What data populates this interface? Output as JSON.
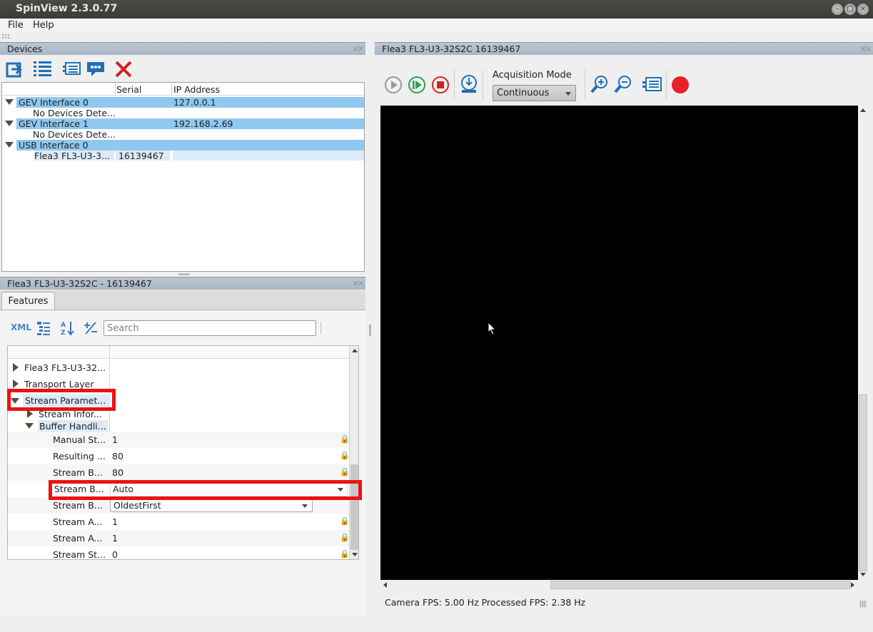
{
  "window": {
    "title": "SpinView 2.3.0.77"
  },
  "menu": {
    "file": "File",
    "help": "Help"
  },
  "devices": {
    "title": "Devices",
    "columns": {
      "serial": "Serial",
      "ip": "IP Address"
    },
    "rows": [
      {
        "name": "GEV Interface 0",
        "serial": "",
        "ip": "127.0.0.1"
      },
      {
        "name": "No Devices Dete...",
        "serial": "",
        "ip": ""
      },
      {
        "name": "GEV Interface 1",
        "serial": "",
        "ip": "192.168.2.69"
      },
      {
        "name": "No Devices Dete...",
        "serial": "",
        "ip": ""
      },
      {
        "name": "USB Interface 0",
        "serial": "",
        "ip": ""
      },
      {
        "name": "Flea3 FL3-U3-3...",
        "serial": "16139467",
        "ip": ""
      }
    ]
  },
  "camera_panel": {
    "title": "Flea3 FL3-U3-32S2C - 16139467",
    "tab": "Features",
    "xml_label": "XML",
    "search_placeholder": "Search",
    "tree": [
      {
        "label": "Flea3 FL3-U3-32...",
        "value": ""
      },
      {
        "label": "Transport Layer",
        "value": ""
      },
      {
        "label": "Stream Paramet...",
        "value": ""
      },
      {
        "label": "Stream Infor...",
        "value": ""
      },
      {
        "label": "Buffer Handli...",
        "value": ""
      },
      {
        "label": "Manual St...",
        "value": "1"
      },
      {
        "label": "Resulting ...",
        "value": "80"
      },
      {
        "label": "Stream B...",
        "value": "80"
      },
      {
        "label": "Stream B...",
        "value": "Auto"
      },
      {
        "label": "Stream B...",
        "value": "OldestFirst"
      },
      {
        "label": "Stream A...",
        "value": "1"
      },
      {
        "label": "Stream A...",
        "value": "1"
      },
      {
        "label": "Stream St...",
        "value": "0"
      }
    ]
  },
  "viewer": {
    "title": "Flea3 FL3-U3-32S2C 16139467",
    "acq_label": "Acquisition Mode",
    "acq_value": "Continuous",
    "status": "Camera FPS: 5.00 Hz  Processed FPS: 2.38 Hz"
  },
  "colors": {
    "header": "#aab6c6",
    "selection": "#8fc8f0",
    "highlight_box": "#ee1111",
    "record": "#e8222a"
  }
}
